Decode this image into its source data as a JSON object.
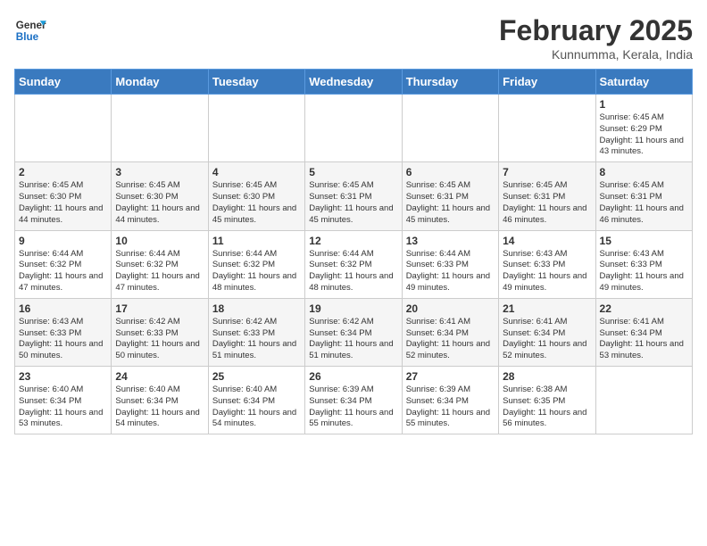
{
  "logo": {
    "line1": "General",
    "line2": "Blue"
  },
  "title": "February 2025",
  "location": "Kunnumma, Kerala, India",
  "weekdays": [
    "Sunday",
    "Monday",
    "Tuesday",
    "Wednesday",
    "Thursday",
    "Friday",
    "Saturday"
  ],
  "weeks": [
    [
      {
        "day": "",
        "info": ""
      },
      {
        "day": "",
        "info": ""
      },
      {
        "day": "",
        "info": ""
      },
      {
        "day": "",
        "info": ""
      },
      {
        "day": "",
        "info": ""
      },
      {
        "day": "",
        "info": ""
      },
      {
        "day": "1",
        "info": "Sunrise: 6:45 AM\nSunset: 6:29 PM\nDaylight: 11 hours\nand 43 minutes."
      }
    ],
    [
      {
        "day": "2",
        "info": "Sunrise: 6:45 AM\nSunset: 6:30 PM\nDaylight: 11 hours\nand 44 minutes."
      },
      {
        "day": "3",
        "info": "Sunrise: 6:45 AM\nSunset: 6:30 PM\nDaylight: 11 hours\nand 44 minutes."
      },
      {
        "day": "4",
        "info": "Sunrise: 6:45 AM\nSunset: 6:30 PM\nDaylight: 11 hours\nand 45 minutes."
      },
      {
        "day": "5",
        "info": "Sunrise: 6:45 AM\nSunset: 6:31 PM\nDaylight: 11 hours\nand 45 minutes."
      },
      {
        "day": "6",
        "info": "Sunrise: 6:45 AM\nSunset: 6:31 PM\nDaylight: 11 hours\nand 45 minutes."
      },
      {
        "day": "7",
        "info": "Sunrise: 6:45 AM\nSunset: 6:31 PM\nDaylight: 11 hours\nand 46 minutes."
      },
      {
        "day": "8",
        "info": "Sunrise: 6:45 AM\nSunset: 6:31 PM\nDaylight: 11 hours\nand 46 minutes."
      }
    ],
    [
      {
        "day": "9",
        "info": "Sunrise: 6:44 AM\nSunset: 6:32 PM\nDaylight: 11 hours\nand 47 minutes."
      },
      {
        "day": "10",
        "info": "Sunrise: 6:44 AM\nSunset: 6:32 PM\nDaylight: 11 hours\nand 47 minutes."
      },
      {
        "day": "11",
        "info": "Sunrise: 6:44 AM\nSunset: 6:32 PM\nDaylight: 11 hours\nand 48 minutes."
      },
      {
        "day": "12",
        "info": "Sunrise: 6:44 AM\nSunset: 6:32 PM\nDaylight: 11 hours\nand 48 minutes."
      },
      {
        "day": "13",
        "info": "Sunrise: 6:44 AM\nSunset: 6:33 PM\nDaylight: 11 hours\nand 49 minutes."
      },
      {
        "day": "14",
        "info": "Sunrise: 6:43 AM\nSunset: 6:33 PM\nDaylight: 11 hours\nand 49 minutes."
      },
      {
        "day": "15",
        "info": "Sunrise: 6:43 AM\nSunset: 6:33 PM\nDaylight: 11 hours\nand 49 minutes."
      }
    ],
    [
      {
        "day": "16",
        "info": "Sunrise: 6:43 AM\nSunset: 6:33 PM\nDaylight: 11 hours\nand 50 minutes."
      },
      {
        "day": "17",
        "info": "Sunrise: 6:42 AM\nSunset: 6:33 PM\nDaylight: 11 hours\nand 50 minutes."
      },
      {
        "day": "18",
        "info": "Sunrise: 6:42 AM\nSunset: 6:33 PM\nDaylight: 11 hours\nand 51 minutes."
      },
      {
        "day": "19",
        "info": "Sunrise: 6:42 AM\nSunset: 6:34 PM\nDaylight: 11 hours\nand 51 minutes."
      },
      {
        "day": "20",
        "info": "Sunrise: 6:41 AM\nSunset: 6:34 PM\nDaylight: 11 hours\nand 52 minutes."
      },
      {
        "day": "21",
        "info": "Sunrise: 6:41 AM\nSunset: 6:34 PM\nDaylight: 11 hours\nand 52 minutes."
      },
      {
        "day": "22",
        "info": "Sunrise: 6:41 AM\nSunset: 6:34 PM\nDaylight: 11 hours\nand 53 minutes."
      }
    ],
    [
      {
        "day": "23",
        "info": "Sunrise: 6:40 AM\nSunset: 6:34 PM\nDaylight: 11 hours\nand 53 minutes."
      },
      {
        "day": "24",
        "info": "Sunrise: 6:40 AM\nSunset: 6:34 PM\nDaylight: 11 hours\nand 54 minutes."
      },
      {
        "day": "25",
        "info": "Sunrise: 6:40 AM\nSunset: 6:34 PM\nDaylight: 11 hours\nand 54 minutes."
      },
      {
        "day": "26",
        "info": "Sunrise: 6:39 AM\nSunset: 6:34 PM\nDaylight: 11 hours\nand 55 minutes."
      },
      {
        "day": "27",
        "info": "Sunrise: 6:39 AM\nSunset: 6:34 PM\nDaylight: 11 hours\nand 55 minutes."
      },
      {
        "day": "28",
        "info": "Sunrise: 6:38 AM\nSunset: 6:35 PM\nDaylight: 11 hours\nand 56 minutes."
      },
      {
        "day": "",
        "info": ""
      }
    ]
  ]
}
